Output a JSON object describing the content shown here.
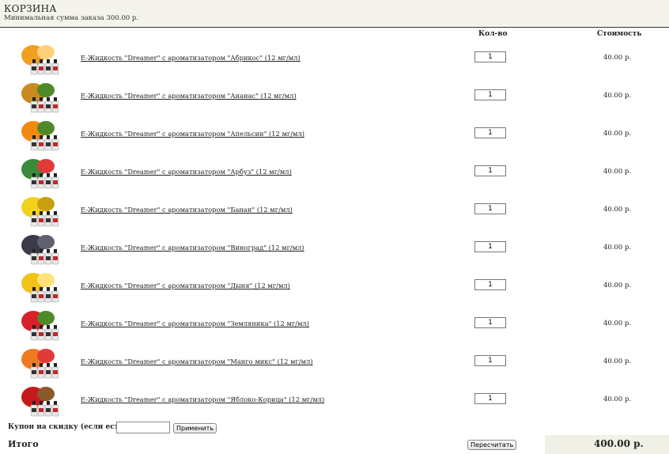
{
  "cart": {
    "title": "КОРЗИНА",
    "min_order": "Минимальная сумма заказа 300.00 р."
  },
  "columns": {
    "qty": "Кол-во",
    "cost": "Стоимость"
  },
  "items": [
    {
      "name": "E-Жидкость \"Dreamer\" с ароматизатором \"Абрикос\" (12 мг/мл)",
      "qty": "1",
      "price": "40.00 р.",
      "icon": "apricot-icon",
      "color": "#f0a020",
      "color2": "#ffd27a"
    },
    {
      "name": "E-Жидкость \"Dreamer\" с ароматизатором \"Ананас\" (12 мг/мл)",
      "qty": "1",
      "price": "40.00 р.",
      "icon": "pineapple-icon",
      "color": "#c98a1e",
      "color2": "#4f8a2a"
    },
    {
      "name": "E-Жидкость \"Dreamer\" с ароматизатором \"Апельсин\" (12 мг/мл)",
      "qty": "1",
      "price": "40.00 р.",
      "icon": "orange-icon",
      "color": "#f28a10",
      "color2": "#4f8a2a"
    },
    {
      "name": "E-Жидкость \"Dreamer\" с ароматизатором \"Арбуз\" (12 мг/мл)",
      "qty": "1",
      "price": "40.00 р.",
      "icon": "watermelon-icon",
      "color": "#3a8a3a",
      "color2": "#e23a3a"
    },
    {
      "name": "E-Жидкость \"Dreamer\" с ароматизатором \"Банан\" (12 мг/мл)",
      "qty": "1",
      "price": "40.00 р.",
      "icon": "banana-icon",
      "color": "#f2d21a",
      "color2": "#c9a010"
    },
    {
      "name": "E-Жидкость \"Dreamer\" с ароматизатором \"Виноград\" (12 мг/мл)",
      "qty": "1",
      "price": "40.00 р.",
      "icon": "grape-icon",
      "color": "#3a3a48",
      "color2": "#606070"
    },
    {
      "name": "E-Жидкость \"Dreamer\" с ароматизатором \"Дыня\" (12 мг/мл)",
      "qty": "1",
      "price": "40.00 р.",
      "icon": "melon-icon",
      "color": "#f2c21a",
      "color2": "#ffe37a"
    },
    {
      "name": "E-Жидкость \"Dreamer\" с ароматизатором \"Земляника\" (12 мг/мл)",
      "qty": "1",
      "price": "40.00 р.",
      "icon": "strawberry-icon",
      "color": "#d8202a",
      "color2": "#4f8a2a"
    },
    {
      "name": "E-Жидкость \"Dreamer\" с ароматизатором \"Манго микс\" (12 мг/мл)",
      "qty": "1",
      "price": "40.00 р.",
      "icon": "mango-icon",
      "color": "#f07a20",
      "color2": "#e23a3a"
    },
    {
      "name": "E-Жидкость \"Dreamer\" с ароматизатором \"Яблоко-Корица\" (12 мг/мл)",
      "qty": "1",
      "price": "40.00 р.",
      "icon": "apple-cinnamon-icon",
      "color": "#c81a1a",
      "color2": "#8a5a2a"
    }
  ],
  "coupon": {
    "label": "Купон на скидку (если есть):",
    "value": "",
    "apply_label": "Применить"
  },
  "footer": {
    "total_label": "Итого",
    "recalc_label": "Пересчитать",
    "total": "400.00 р."
  }
}
